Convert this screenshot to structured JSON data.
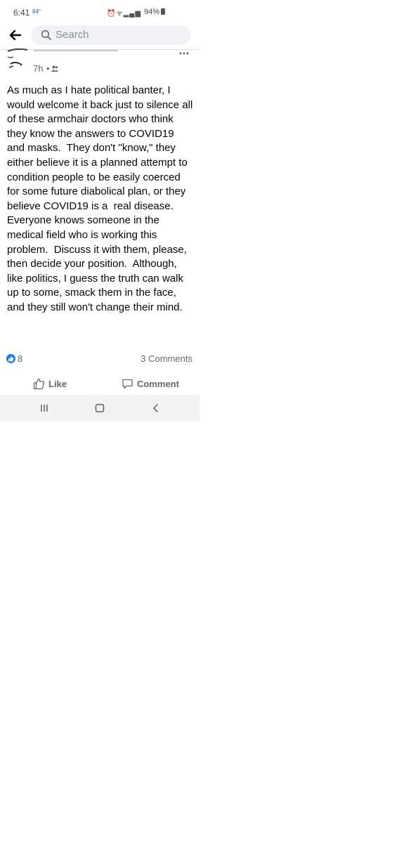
{
  "status_bar": {
    "time": "6:41",
    "temperature": "64°",
    "icons": [
      "alarm-icon",
      "wifi-icon",
      "signal-icon"
    ],
    "battery": "94%"
  },
  "header": {
    "search_placeholder": "Search",
    "back_icon": "back-arrow-icon"
  },
  "post": {
    "time": "7h",
    "separator": "•",
    "audience_icon": "friends-icon",
    "text": "As much as I hate political banter, I would welcome it back just to silence all of these armchair doctors who think they know the answers to COVID19 and masks.  They don't \"know,\" they either believe it is a planned attempt to condition people to be easily coerced for some future diabolical plan, or they believe COVID19 is a  real disease.  Everyone knows someone in the medical field who is working this problem.  Discuss it with them, please, then decide your position.  Although, like politics, I guess the truth can walk up to some, smack them in the face, and they still won't change their mind.",
    "reaction_count": "8",
    "comments": "3 Comments"
  },
  "actions": {
    "like_label": "Like",
    "comment_label": "Comment"
  },
  "colors": {
    "accent": "#1877f2",
    "muted_text": "#65676b",
    "search_bg": "#f0f2f5",
    "nav_bg": "#f2f2f2"
  }
}
